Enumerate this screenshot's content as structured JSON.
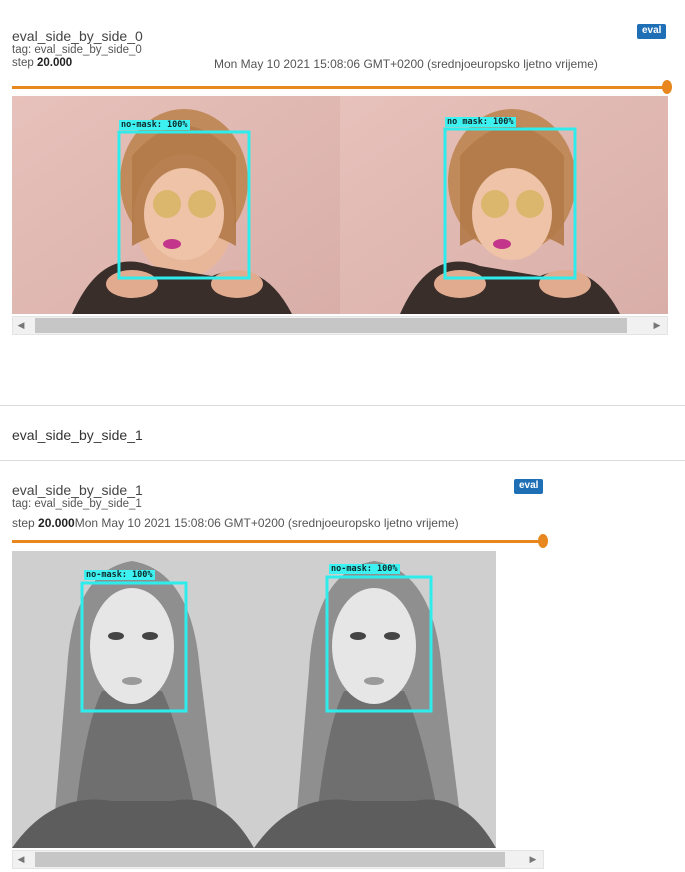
{
  "colors": {
    "accent_orange": "#e8871e",
    "badge_blue": "#1e6fb5",
    "bbox_cyan": "#2fecec"
  },
  "card1": {
    "title": "eval_side_by_side_0",
    "tag": "tag: eval_side_by_side_0",
    "step_label": "step",
    "step_value": "20.000",
    "timestamp": "Mon May 10 2021 15:08:06 GMT+0200 (srednjoeuropsko ljetno vrijeme)",
    "badge": "eval",
    "detections": [
      "no-mask: 100%",
      "no mask: 100%"
    ]
  },
  "section2": {
    "title": "eval_side_by_side_1"
  },
  "card2": {
    "title": "eval_side_by_side_1",
    "tag": "tag: eval_side_by_side_1",
    "step_label": "step",
    "step_value": "20.000",
    "timestamp": "Mon May 10 2021 15:08:06 GMT+0200 (srednjoeuropsko ljetno vrijeme)",
    "badge": "eval",
    "detections": [
      "no-mask: 100%",
      "no-mask: 100%"
    ]
  },
  "icons": {
    "scroll_left": "triangle-left",
    "scroll_right": "triangle-right"
  }
}
